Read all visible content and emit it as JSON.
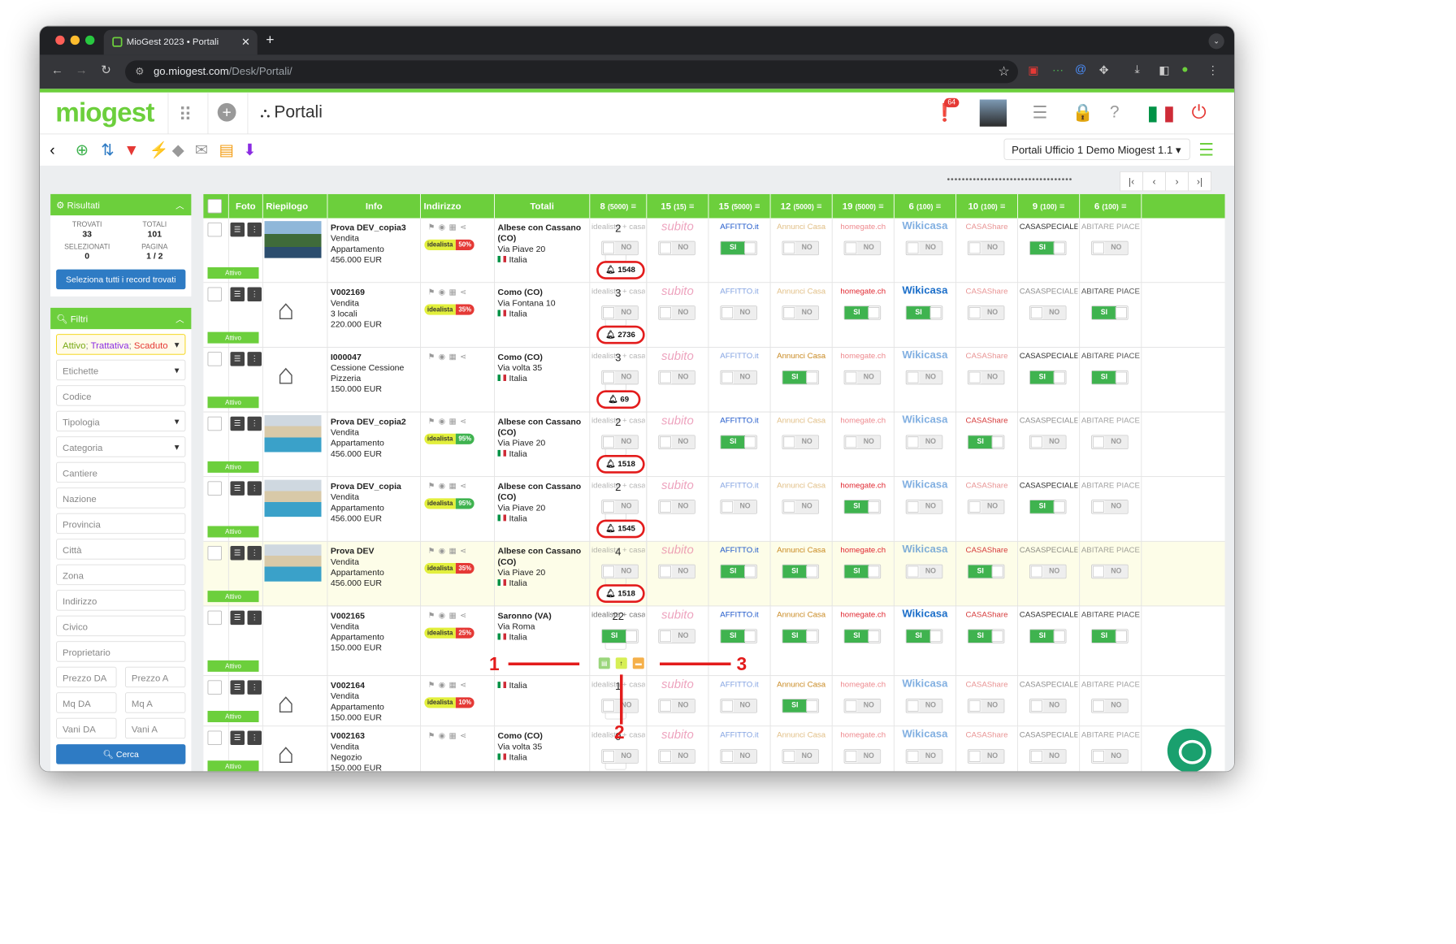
{
  "browser": {
    "tab_title": "MioGest 2023 • Portali",
    "url_domain": "go.miogest.com",
    "url_path": "/Desk/Portali/",
    "dot_colors": [
      "#ff5f57",
      "#febc2e",
      "#28c840"
    ]
  },
  "app": {
    "logo": "miogest",
    "page_title": "Portali",
    "notification_count": "64",
    "office_select": "Portali Ufficio 1 Demo Miogest 1.1",
    "accent": "#6ccf3c"
  },
  "results": {
    "header": "Risultati",
    "trovati_label": "TROVATI",
    "trovati": "33",
    "totali_label": "TOTALI",
    "totali": "101",
    "selezionati_label": "SELEZIONATI",
    "selezionati": "0",
    "pagina_label": "PAGINA",
    "pagina": "1 / 2",
    "select_all": "Seleziona tutti i record trovati"
  },
  "filters": {
    "header": "Filtri",
    "status_a": "Attivo",
    "status_b": "Trattativa",
    "status_c": "Scaduto",
    "etichette": "Etichette",
    "codice": "Codice",
    "tipologia": "Tipologia",
    "categoria": "Categoria",
    "cantiere": "Cantiere",
    "nazione": "Nazione",
    "provincia": "Provincia",
    "citta": "Città",
    "zona": "Zona",
    "indirizzo": "Indirizzo",
    "civico": "Civico",
    "proprietario": "Proprietario",
    "prezzo_da": "Prezzo DA",
    "prezzo_a": "Prezzo A",
    "mq_da": "Mq DA",
    "mq_a": "Mq A",
    "vani_da": "Vani DA",
    "vani_a": "Vani A",
    "search": "Cerca"
  },
  "columns": {
    "foto": "Foto",
    "riepilogo": "Riepilogo",
    "info": "Info",
    "indirizzo": "Indirizzo",
    "totali": "Totali",
    "portals": [
      {
        "n": "8",
        "cap": "(5000)"
      },
      {
        "n": "15",
        "cap": "(15)"
      },
      {
        "n": "15",
        "cap": "(5000)"
      },
      {
        "n": "12",
        "cap": "(5000)"
      },
      {
        "n": "19",
        "cap": "(5000)"
      },
      {
        "n": "6",
        "cap": "(100)"
      },
      {
        "n": "10",
        "cap": "(100)"
      },
      {
        "n": "9",
        "cap": "(100)"
      },
      {
        "n": "6",
        "cap": "(100)"
      }
    ]
  },
  "portal_logos": [
    "idealista + casa.it",
    "subito",
    "AFFITTO.it",
    "Annunci Casa",
    "homegate.ch",
    "Wikicasa",
    "CASAShare",
    "CASASPECIALE.IT",
    "ABITARE PIACENZA"
  ],
  "portal_logo_colors": [
    "#777",
    "#e0588a",
    "#1b55c9",
    "#c98a22",
    "#e0262f",
    "#1b6ec9",
    "#d63b3b",
    "#333",
    "#555"
  ],
  "labels": {
    "attivo": "Attivo",
    "si": "SI",
    "no": "NO"
  },
  "rows": [
    {
      "title": "Prova DEV_copia3",
      "l2": "Vendita",
      "l3": "Appartamento",
      "l4": "456.000 EUR",
      "city": "Albese con Cassano (CO)",
      "street": "Via Piave 20",
      "country": "Italia",
      "pct": "50%",
      "pct_color": "#e53935",
      "total": "2",
      "bell": "1548",
      "photo": "lake",
      "portals": [
        0,
        0,
        1,
        0,
        0,
        0,
        0,
        1,
        0
      ]
    },
    {
      "title": "V002169",
      "l2": "Vendita",
      "l3": "3 locali",
      "l4": "220.000 EUR",
      "city": "Como (CO)",
      "street": "Via Fontana 10",
      "country": "Italia",
      "pct": "35%",
      "pct_color": "#e53935",
      "total": "3",
      "bell": "2736",
      "photo": "house",
      "portals": [
        0,
        0,
        0,
        0,
        1,
        1,
        0,
        0,
        1
      ]
    },
    {
      "title": "I000047",
      "l2": "Cessione Cessione",
      "l3": "Pizzeria",
      "l4": "150.000 EUR",
      "city": "Como (CO)",
      "street": "Via volta 35",
      "country": "Italia",
      "pct": "",
      "pct_color": "",
      "total": "3",
      "bell": "69",
      "photo": "house",
      "portals": [
        0,
        0,
        0,
        1,
        0,
        0,
        0,
        1,
        1
      ]
    },
    {
      "title": "Prova DEV_copia2",
      "l2": "Vendita",
      "l3": "Appartamento",
      "l4": "456.000 EUR",
      "city": "Albese con Cassano (CO)",
      "street": "Via Piave 20",
      "country": "Italia",
      "pct": "95%",
      "pct_color": "#3fb34f",
      "total": "2",
      "bell": "1518",
      "photo": "pool",
      "portals": [
        0,
        0,
        1,
        0,
        0,
        0,
        1,
        0,
        0
      ]
    },
    {
      "title": "Prova DEV_copia",
      "l2": "Vendita",
      "l3": "Appartamento",
      "l4": "456.000 EUR",
      "city": "Albese con Cassano (CO)",
      "street": "Via Piave 20",
      "country": "Italia",
      "pct": "95%",
      "pct_color": "#3fb34f",
      "total": "2",
      "bell": "1545",
      "photo": "pool",
      "portals": [
        0,
        0,
        0,
        0,
        1,
        0,
        0,
        1,
        0
      ]
    },
    {
      "title": "Prova DEV",
      "l2": "Vendita",
      "l3": "Appartamento",
      "l4": "456.000 EUR",
      "city": "Albese con Cassano (CO)",
      "street": "Via Piave 20",
      "country": "Italia",
      "pct": "35%",
      "pct_color": "#e53935",
      "total": "4",
      "bell": "1518",
      "photo": "pool",
      "portals": [
        0,
        0,
        1,
        1,
        1,
        0,
        1,
        0,
        0
      ]
    },
    {
      "title": "V002165",
      "l2": "Vendita",
      "l3": "Appartamento",
      "l4": "150.000 EUR",
      "city": "Saronno (VA)",
      "street": "Via Roma",
      "country": "Italia",
      "pct": "25%",
      "pct_color": "#e53935",
      "total": "22",
      "bell": "",
      "photo": "",
      "portals": [
        1,
        0,
        1,
        1,
        1,
        1,
        1,
        1,
        1
      ]
    },
    {
      "title": "V002164",
      "l2": "Vendita",
      "l3": "Appartamento",
      "l4": "150.000 EUR",
      "city": "",
      "street": "",
      "country": "Italia",
      "pct": "10%",
      "pct_color": "#e53935",
      "total": "1",
      "bell": "",
      "photo": "house",
      "portals": [
        0,
        0,
        0,
        1,
        0,
        0,
        0,
        0,
        0
      ]
    },
    {
      "title": "V002163",
      "l2": "Vendita",
      "l3": "Negozio",
      "l4": "150.000 EUR",
      "city": "Como (CO)",
      "street": "Via volta 35",
      "country": "Italia",
      "pct": "",
      "pct_color": "",
      "total": "0",
      "bell": "",
      "photo": "house",
      "portals": [
        0,
        0,
        0,
        0,
        0,
        0,
        0,
        0,
        0
      ]
    }
  ],
  "annotations": {
    "one": "1",
    "two": "2",
    "three": "3"
  },
  "icons": [
    "back-arrow-icon",
    "add-circle-icon",
    "sort-icon",
    "filter-icon",
    "bolt-icon",
    "tag-icon",
    "mail-icon",
    "print-icon",
    "download-icon",
    "bell-icon",
    "house-icon",
    "menu-icon",
    "chat-icon"
  ]
}
